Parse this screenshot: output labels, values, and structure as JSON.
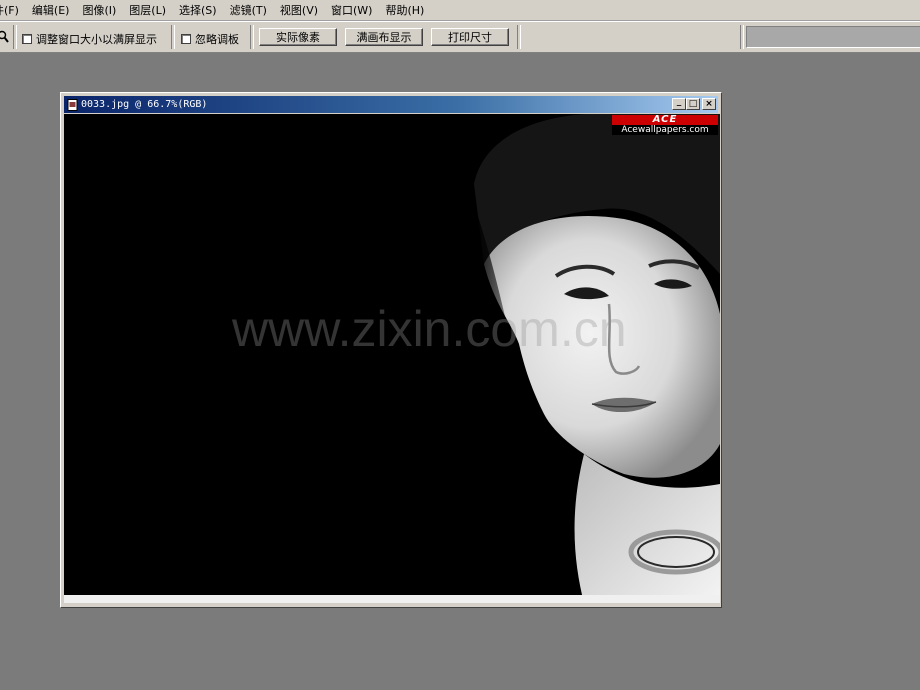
{
  "menu": [
    {
      "label": "文件(F)"
    },
    {
      "label": "编辑(E)"
    },
    {
      "label": "图像(I)"
    },
    {
      "label": "图层(L)"
    },
    {
      "label": "选择(S)"
    },
    {
      "label": "滤镜(T)"
    },
    {
      "label": "视图(V)"
    },
    {
      "label": "窗口(W)"
    },
    {
      "label": "帮助(H)"
    }
  ],
  "options": {
    "resize_windows_label": "调整窗口大小以满屏显示",
    "ignore_palettes_label": "忽略调板",
    "actual_pixels_label": "实际像素",
    "fit_on_screen_label": "满画布显示",
    "print_size_label": "打印尺寸"
  },
  "document": {
    "title": "0033.jpg @ 66.7%(RGB)",
    "minimize": "_",
    "maximize": "□",
    "close": "×"
  },
  "image": {
    "logo_text": "ACE",
    "logo_site": "Acewallpapers.com",
    "watermark": "www.zixin.com.cn"
  },
  "colors": {
    "chrome": "#d4d0c8",
    "workspace": "#7b7b7b",
    "titlebar_start": "#0a246a",
    "titlebar_end": "#a6caf0"
  }
}
